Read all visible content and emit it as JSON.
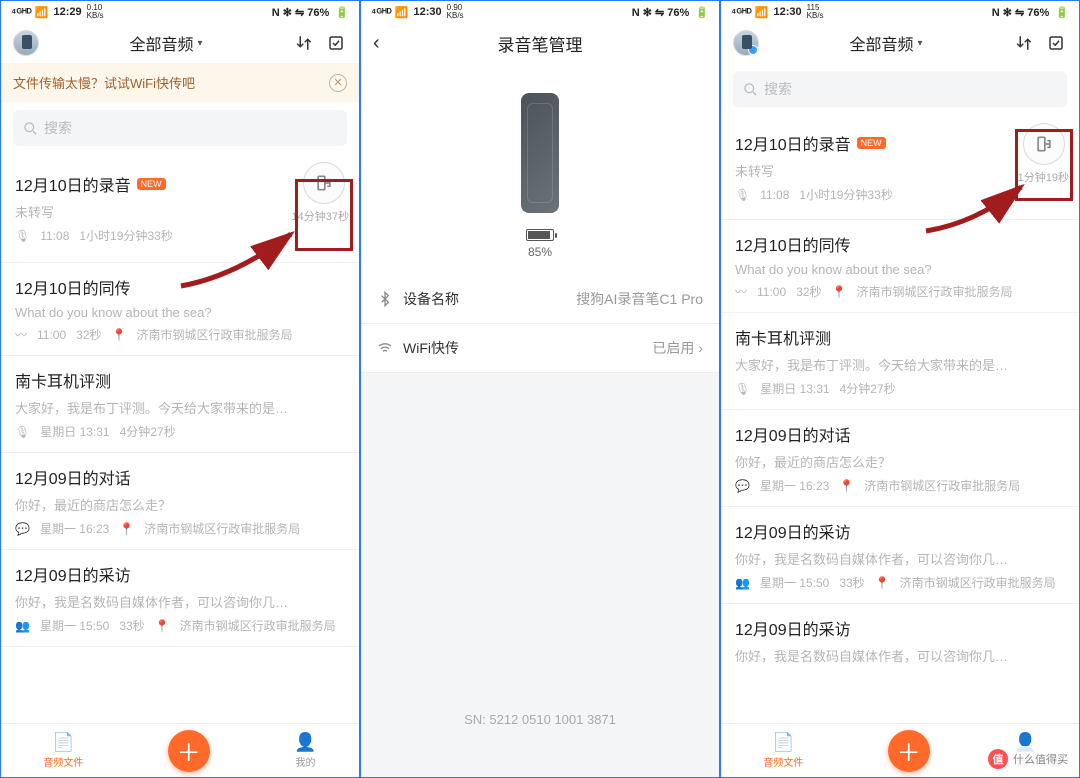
{
  "status": {
    "time1": "12:29",
    "time2": "12:30",
    "time3": "12:30",
    "kbs1": "0.10",
    "kbs2": "0.90",
    "kbs3": "115",
    "kbsUnit": "KB/s",
    "net": "4G HD",
    "right": "N ✻ ⇋ 76%"
  },
  "header": {
    "title": "全部音频",
    "sort_icon": "↑↓",
    "check_icon": "☑"
  },
  "banner": {
    "text": "文件传输太慢？试试WiFi快传吧"
  },
  "search": {
    "placeholder": "搜索"
  },
  "pane1_sync_time": "14分钟37秒",
  "pane3_sync_time": "1分钟19秒",
  "items": [
    {
      "title": "12月10日的录音",
      "new": "NEW",
      "sub": "未转写",
      "meta_icon": "mic",
      "meta1": "11:08",
      "meta2": "1小时19分钟33秒"
    },
    {
      "title": "12月10日的同传",
      "sub": "What do you know about the sea?",
      "meta_icon": "wave",
      "meta1": "11:00",
      "meta2": "32秒",
      "loc": "济南市钢城区行政审批服务局"
    },
    {
      "title": "南卡耳机评测",
      "sub": "大家好，我是布丁评测。今天给大家带来的是…",
      "meta_icon": "mic",
      "meta1": "星期日 13:31",
      "meta2": "4分钟27秒"
    },
    {
      "title": "12月09日的对话",
      "sub": "你好，最近的商店怎么走？",
      "meta_icon": "chat",
      "meta1": "星期一 16:23",
      "loc": "济南市钢城区行政审批服务局"
    },
    {
      "title": "12月09日的采访",
      "sub": "你好，我是名数码自媒体作者，可以咨询你几…",
      "meta_icon": "people",
      "meta1": "星期一 15:50",
      "meta2": "33秒",
      "loc": "济南市钢城区行政审批服务局"
    },
    {
      "title": "12月09日的采访",
      "sub": "你好，我是名数码自媒体作者，可以咨询你几…"
    }
  ],
  "tabs": {
    "files": "音频文件",
    "mine": "我的"
  },
  "pane2": {
    "title": "录音笔管理",
    "battery": "85%",
    "device_label": "设备名称",
    "device_value": "搜狗AI录音笔C1 Pro",
    "wifi_label": "WiFi快传",
    "wifi_value": "已启用",
    "sn": "SN: 5212 0510 1001 3871"
  },
  "watermark": {
    "badge": "值",
    "text": "什么值得买"
  }
}
